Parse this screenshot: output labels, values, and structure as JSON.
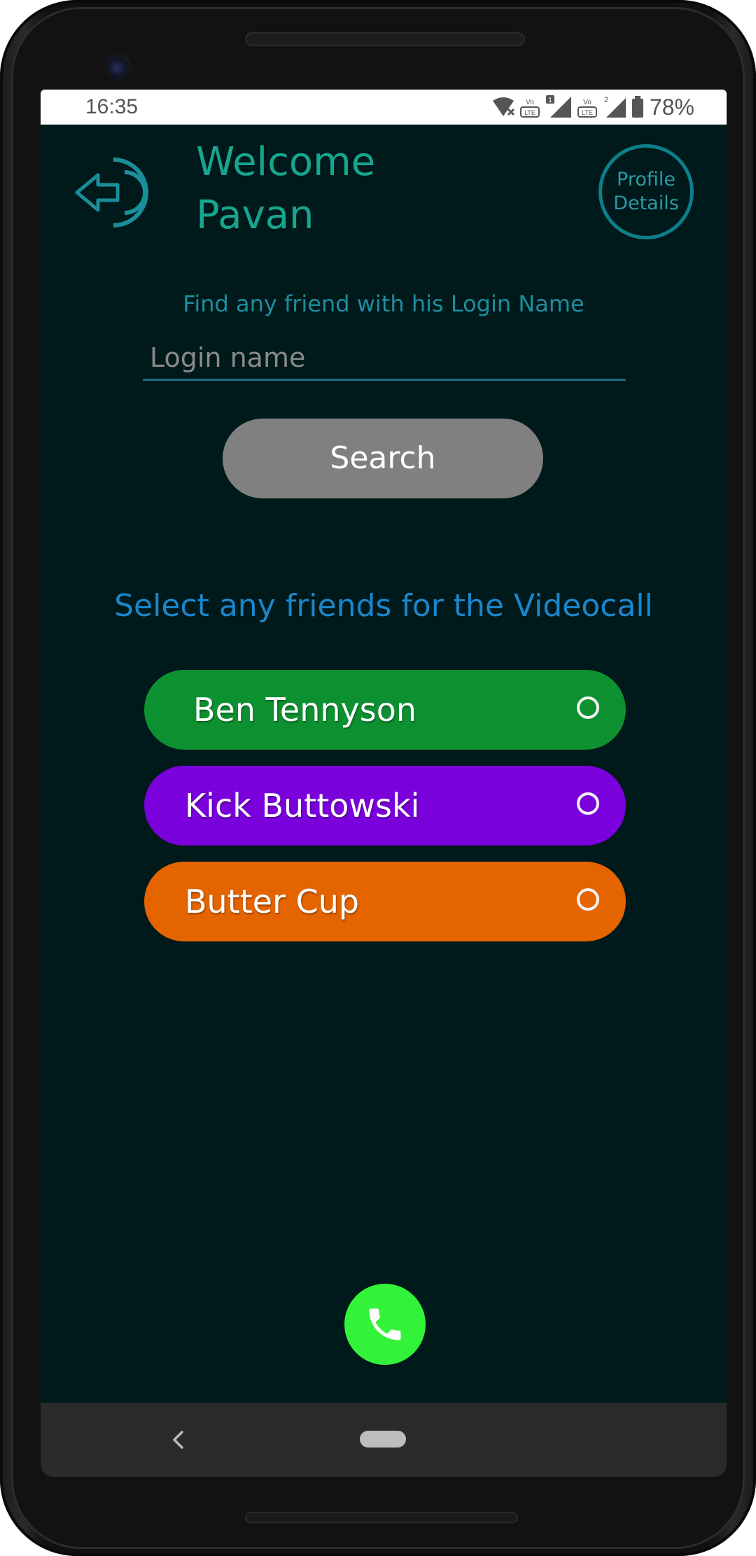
{
  "status_bar": {
    "time": "16:35",
    "battery_percent": "78%",
    "icons": [
      "wifi-icon",
      "volte-icon",
      "sim1-signal-icon",
      "volte-icon",
      "sim2-signal-icon",
      "battery-icon"
    ]
  },
  "header": {
    "welcome_line1": "Welcome",
    "welcome_line2": "Pavan",
    "logout_icon": "logout-icon",
    "profile_line1": "Profile",
    "profile_line2": "Details"
  },
  "search": {
    "label": "Find any friend with his Login Name",
    "placeholder": "Login name",
    "value": "",
    "button_label": "Search"
  },
  "friends": {
    "label": "Select any friends for the Videocall",
    "items": [
      {
        "name": "Ben Tennyson",
        "color": "#0d9130",
        "selected": false
      },
      {
        "name": "Kick Buttowski",
        "color": "#7a00dc",
        "selected": false
      },
      {
        "name": "Butter Cup",
        "color": "#e46400",
        "selected": false
      }
    ]
  },
  "call": {
    "icon": "phone-icon",
    "color": "#33f23a"
  },
  "nav": {
    "back_icon": "back-icon",
    "home_icon": "home-pill-icon"
  },
  "theme": {
    "background": "#00191a",
    "accent": "#17a58f",
    "info_text": "#1a86cc"
  }
}
